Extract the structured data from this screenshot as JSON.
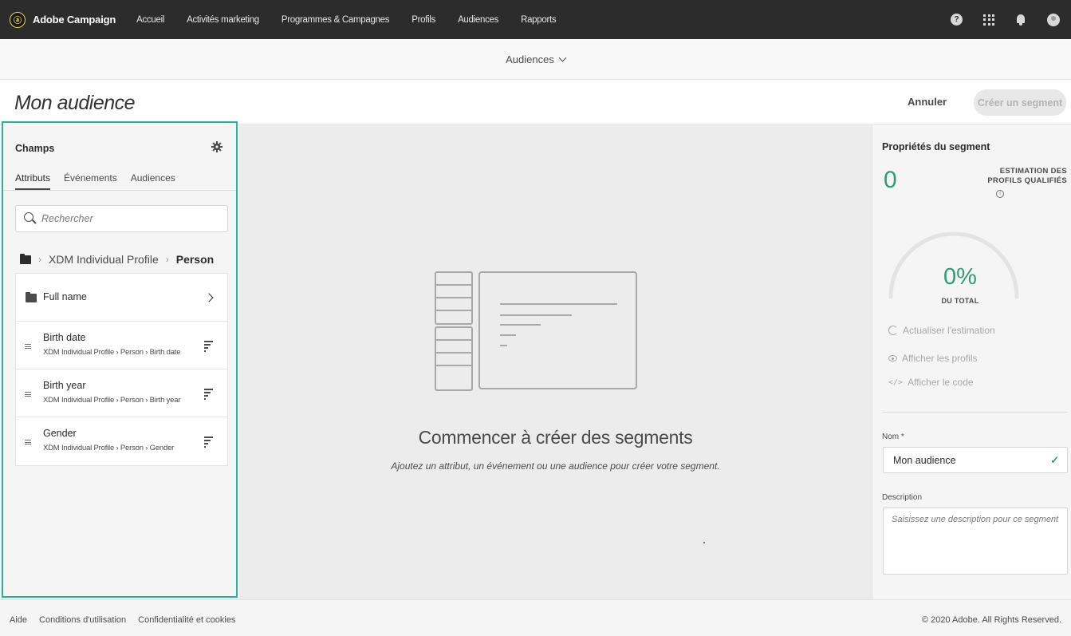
{
  "nav": {
    "brand": "Adobe Campaign",
    "items": [
      "Accueil",
      "Activités marketing",
      "Programmes & Campagnes",
      "Profils",
      "Audiences",
      "Rapports"
    ],
    "icons": [
      "help-icon",
      "apps-grid-icon",
      "bell-icon",
      "avatar"
    ]
  },
  "subbar": {
    "title": "Audiences"
  },
  "header": {
    "title": "Mon audience",
    "cancel_label": "Annuler",
    "create_label": "Créer un segment"
  },
  "fields_panel": {
    "title": "Champs",
    "tabs": [
      "Attributs",
      "Événements",
      "Audiences"
    ],
    "active_tab": "Attributs",
    "search_placeholder": "Rechercher",
    "breadcrumb": [
      "XDM Individual Profile",
      "Person"
    ],
    "folder": {
      "label": "Full name"
    },
    "items": [
      {
        "title": "Birth date",
        "path": "XDM Individual Profile › Person › Birth date"
      },
      {
        "title": "Birth year",
        "path": "XDM Individual Profile › Person › Birth year"
      },
      {
        "title": "Gender",
        "path": "XDM Individual Profile › Person › Gender"
      }
    ]
  },
  "canvas": {
    "title": "Commencer à créer des segments",
    "subtitle": "Ajoutez un attribut, un événement ou une audience pour créer votre segment."
  },
  "properties": {
    "title": "Propriétés du segment",
    "count": "0",
    "estimate_label": "ESTIMATION DES PROFILS QUALIFIÉS",
    "percent": "0%",
    "percent_label": "DU TOTAL",
    "percent_value": 0,
    "actions": [
      "Actualiser l'estimation",
      "Afficher les profils",
      "Afficher le code"
    ],
    "name_label": "Nom *",
    "name_value": "Mon audience",
    "description_label": "Description",
    "description_placeholder": "Saisissez une description pour ce segment"
  },
  "footer": {
    "links": [
      "Aide",
      "Conditions d'utilisation",
      "Confidentialité et cookies"
    ],
    "copyright": "© 2020 Adobe. All Rights Reserved."
  },
  "colors": {
    "accent": "#2d9d78",
    "highlight": "#23b49a",
    "topbar": "#2c2c2c"
  }
}
